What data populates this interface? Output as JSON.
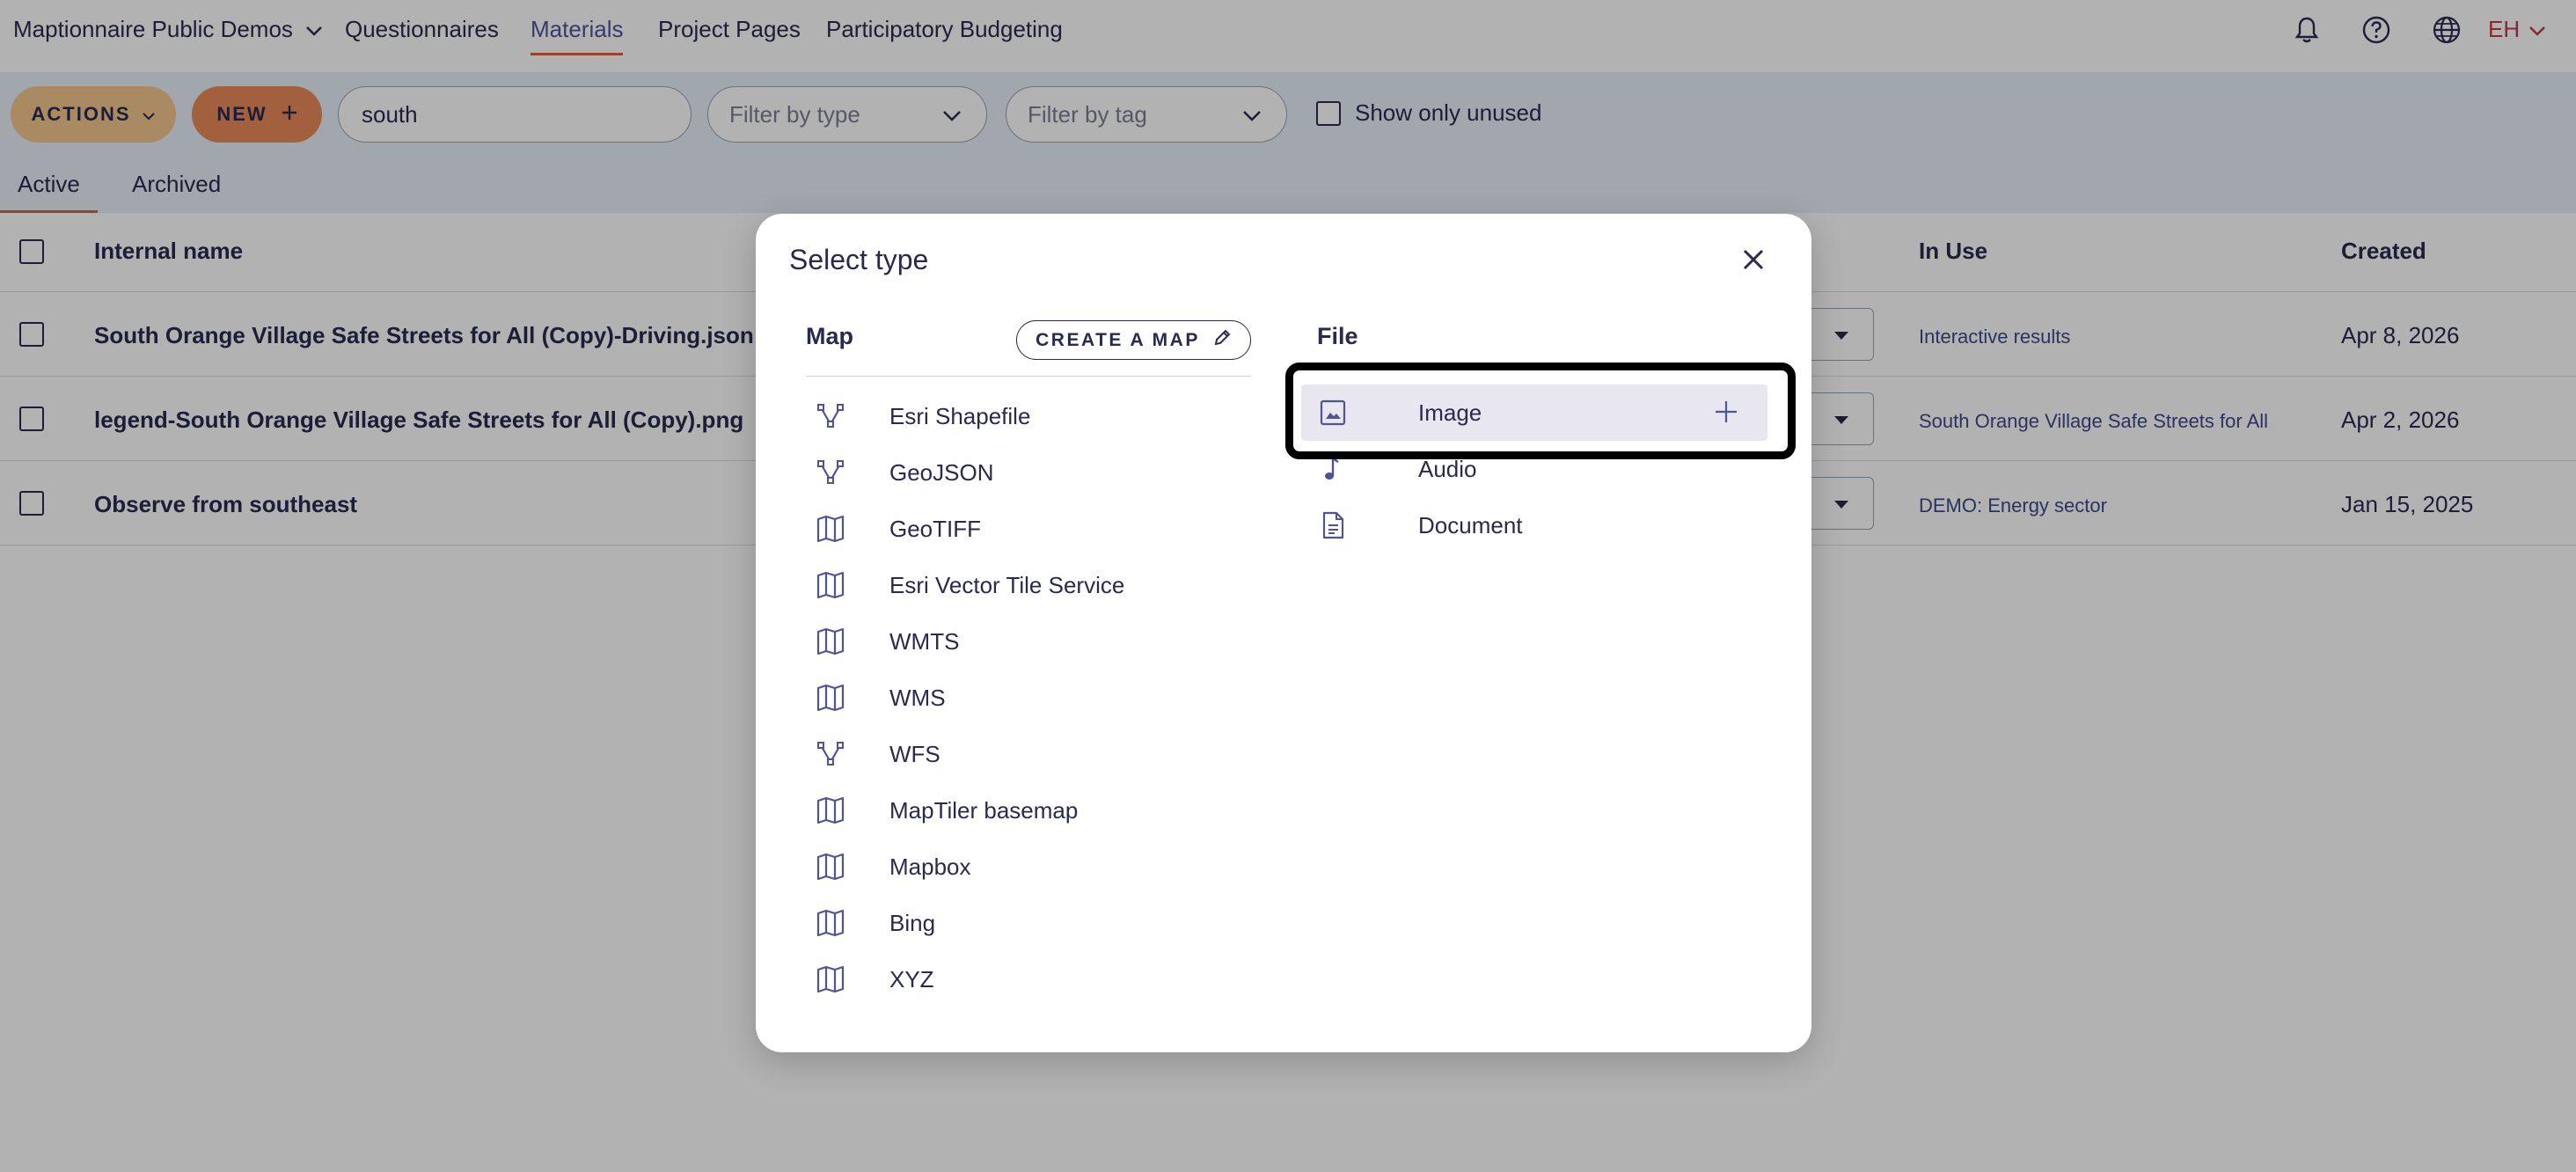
{
  "nav": {
    "org": "Maptionnaire Public Demos",
    "links": [
      "Questionnaires",
      "Materials",
      "Project Pages",
      "Participatory Budgeting"
    ],
    "initials": "EH"
  },
  "toolbar": {
    "actions_label": "ACTIONS",
    "new_label": "NEW",
    "search_value": "south",
    "filter_type_placeholder": "Filter by type",
    "filter_tag_placeholder": "Filter by tag",
    "show_unused_label": "Show only unused"
  },
  "tabs": [
    "Active",
    "Archived"
  ],
  "table": {
    "headers": {
      "name": "Internal name",
      "in_use": "In Use",
      "created": "Created"
    },
    "rows": [
      {
        "name": "South Orange Village Safe Streets for All (Copy)-Driving.json",
        "in_use": "Interactive results",
        "created": "Apr 8, 2026"
      },
      {
        "name": "legend-South Orange Village Safe Streets for All (Copy).png",
        "in_use": "South Orange Village Safe Streets for All",
        "created": "Apr 2, 2026"
      },
      {
        "name": "Observe from southeast",
        "in_use": "DEMO: Energy sector",
        "created": "Jan 15, 2025"
      }
    ]
  },
  "modal": {
    "title": "Select type",
    "map_heading": "Map",
    "create_map_label": "CREATE A MAP",
    "file_heading": "File",
    "map_items": [
      {
        "label": "Esri Shapefile",
        "icon": "vector-icon"
      },
      {
        "label": "GeoJSON",
        "icon": "vector-icon"
      },
      {
        "label": "GeoTIFF",
        "icon": "map-icon"
      },
      {
        "label": "Esri Vector Tile Service",
        "icon": "map-icon"
      },
      {
        "label": "WMTS",
        "icon": "map-icon"
      },
      {
        "label": "WMS",
        "icon": "map-icon"
      },
      {
        "label": "WFS",
        "icon": "vector-icon"
      },
      {
        "label": "MapTiler basemap",
        "icon": "map-icon"
      },
      {
        "label": "Mapbox",
        "icon": "map-icon"
      },
      {
        "label": "Bing",
        "icon": "map-icon"
      },
      {
        "label": "XYZ",
        "icon": "map-icon"
      }
    ],
    "file_items": [
      {
        "label": "Image",
        "icon": "image-icon"
      },
      {
        "label": "Audio",
        "icon": "music-note-icon"
      },
      {
        "label": "Document",
        "icon": "document-icon"
      }
    ]
  },
  "colors": {
    "accent": "#d7603a",
    "text": "#2a2a4f",
    "toolbar_bg": "#e7f0f7",
    "actions_btn": "#f3c68d",
    "new_btn": "#e88a5a",
    "highlight": "#e8e7f0"
  }
}
